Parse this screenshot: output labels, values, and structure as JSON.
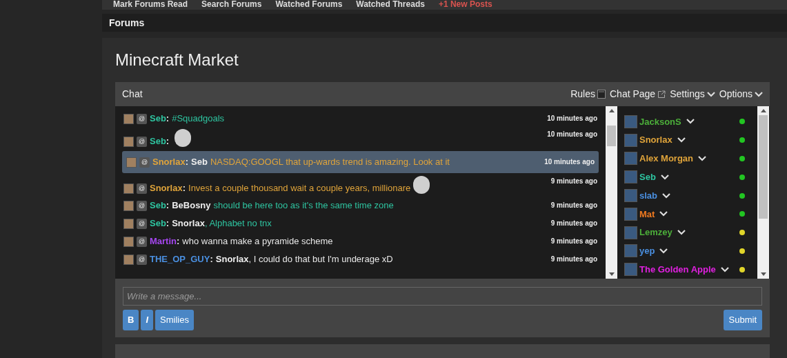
{
  "top_nav": [
    "Mark Forums Read",
    "Search Forums",
    "Watched Forums",
    "Watched Threads",
    "+1 New Posts"
  ],
  "breadcrumb": "Forums",
  "page_title": "Minecraft Market",
  "chat": {
    "title": "Chat",
    "header_links": [
      {
        "label": "Rules",
        "kind": "doc"
      },
      {
        "label": "Chat Page",
        "kind": "external"
      },
      {
        "label": "Settings",
        "kind": "menu"
      },
      {
        "label": "Options",
        "kind": "menu"
      }
    ],
    "messages": [
      {
        "badge": "@",
        "author": "Seb",
        "separator": ":",
        "color": "#2ec4a0",
        "text_colored": true,
        "highlighted": false,
        "time": "10 minutes ago",
        "parts": [
          {
            "kind": "text",
            "text": "#Squadgoals"
          }
        ]
      },
      {
        "badge": "@",
        "author": "Seb",
        "separator": ":",
        "color": "#2ec4a0",
        "highlighted": false,
        "time": "10 minutes ago",
        "parts": [
          {
            "kind": "smiley"
          }
        ]
      },
      {
        "badge": "@",
        "author": "Snorlax",
        "separator": ":",
        "color": "#e0a43a",
        "text_colored": true,
        "highlighted": true,
        "time": "10 minutes ago",
        "parts": [
          {
            "kind": "mention",
            "text": "Seb"
          },
          {
            "kind": "text",
            "text": "NASDAQ:GOOGL that up-wards trend is amazing. Look at it"
          }
        ]
      },
      {
        "badge": "@",
        "author": "Snorlax",
        "separator": ":",
        "color": "#e0a43a",
        "text_colored": true,
        "highlighted": false,
        "time": "9 minutes ago",
        "parts": [
          {
            "kind": "text",
            "text": "Invest a couple thousand wait a couple years, millionare"
          },
          {
            "kind": "smiley"
          }
        ]
      },
      {
        "badge": "@",
        "author": "Seb",
        "separator": ":",
        "color": "#2ec4a0",
        "text_colored": true,
        "highlighted": false,
        "time": "9 minutes ago",
        "parts": [
          {
            "kind": "mention",
            "text": "BeBosny"
          },
          {
            "kind": "text",
            "text": "should be here too as it's the same time zone"
          }
        ]
      },
      {
        "badge": "@",
        "author": "Seb",
        "separator": ":",
        "color": "#2ec4a0",
        "text_colored": true,
        "highlighted": false,
        "time": "9 minutes ago",
        "parts": [
          {
            "kind": "mention",
            "text": "Snorlax"
          },
          {
            "kind": "text",
            "text": ", Alphabet no tnx"
          }
        ]
      },
      {
        "badge": "@",
        "author": "Martin",
        "separator": ":",
        "color": "#a546f0",
        "text_colored": false,
        "highlighted": false,
        "time": "9 minutes ago",
        "parts": [
          {
            "kind": "text",
            "text": "who wanna make a pyramide scheme"
          }
        ]
      },
      {
        "badge": "@",
        "author": "THE_OP_GUY",
        "separator": ":",
        "color": "#4a8fe0",
        "text_colored": false,
        "highlighted": false,
        "time": "9 minutes ago",
        "parts": [
          {
            "kind": "mention",
            "text": "Snorlax"
          },
          {
            "kind": "text",
            "text": ", I could do that but I'm underage xD"
          }
        ]
      }
    ],
    "users": [
      {
        "name": "JacksonS",
        "color": "#4caf3a",
        "away": false
      },
      {
        "name": "Snorlax",
        "color": "#e0a43a",
        "away": false
      },
      {
        "name": "Alex Morgan",
        "color": "#e0a43a",
        "away": false
      },
      {
        "name": "Seb",
        "color": "#2ec4a0",
        "away": false
      },
      {
        "name": "slab",
        "color": "#4a8fe0",
        "away": false
      },
      {
        "name": "Mat",
        "color": "#f07a20",
        "away": false
      },
      {
        "name": "Lemzey",
        "color": "#4caf3a",
        "away": true
      },
      {
        "name": "yep",
        "color": "#4a8fe0",
        "away": true
      },
      {
        "name": "The Golden Apple",
        "color": "#e020e0",
        "away": true
      }
    ],
    "input": {
      "placeholder": "Write a message..."
    },
    "format_buttons": [
      "B",
      "I",
      "Smilies"
    ],
    "submit": "Submit"
  }
}
